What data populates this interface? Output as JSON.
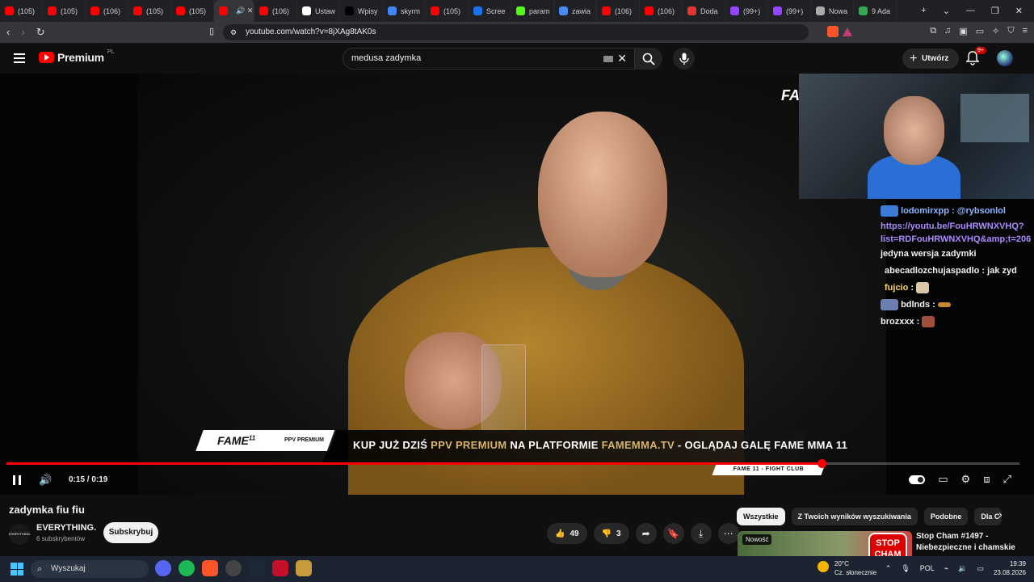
{
  "browser": {
    "tabs": [
      {
        "label": "(105)",
        "icon": "youtube-icon",
        "color": "#ff0000"
      },
      {
        "label": "(105)",
        "icon": "youtube-icon",
        "color": "#ff0000"
      },
      {
        "label": "(106)",
        "icon": "youtube-icon",
        "color": "#ff0000"
      },
      {
        "label": "(105)",
        "icon": "youtube-icon",
        "color": "#ff0000"
      },
      {
        "label": "(105)",
        "icon": "youtube-icon",
        "color": "#ff0000"
      },
      {
        "label": "",
        "icon": "youtube-icon",
        "color": "#ff0000",
        "active": true
      },
      {
        "label": "(106)",
        "icon": "youtube-icon",
        "color": "#ff0000"
      },
      {
        "label": "Ustaw",
        "icon": "page-icon",
        "color": "#ffffff"
      },
      {
        "label": "Wpisy",
        "icon": "x-icon",
        "color": "#000000"
      },
      {
        "label": "skyrm",
        "icon": "google-icon",
        "color": "#4285f4"
      },
      {
        "label": "(105)",
        "icon": "youtube-icon",
        "color": "#ff0000"
      },
      {
        "label": "Scree",
        "icon": "screen-icon",
        "color": "#1a73e8"
      },
      {
        "label": "param",
        "icon": "k-icon",
        "color": "#53fc18"
      },
      {
        "label": "zawia",
        "icon": "doc-icon",
        "color": "#4a8af4"
      },
      {
        "label": "(106)",
        "icon": "youtube-icon",
        "color": "#ff0000"
      },
      {
        "label": "(106)",
        "icon": "youtube-icon",
        "color": "#ff0000"
      },
      {
        "label": "Doda",
        "icon": "dodaj-icon",
        "color": "#e3342f"
      },
      {
        "label": "(99+)",
        "icon": "twitch-icon",
        "color": "#9146ff"
      },
      {
        "label": "(99+)",
        "icon": "twitch-icon",
        "color": "#9146ff"
      },
      {
        "label": "Nowa",
        "icon": "shield-icon",
        "color": "#aaaaaa"
      },
      {
        "label": "9 Ada",
        "icon": "maps-icon",
        "color": "#34a853"
      }
    ],
    "url": "youtube.com/watch?v=8jXAg8tAK0s"
  },
  "youtube": {
    "logo_text": "Premium",
    "region": "PL",
    "search_query": "medusa zadymka",
    "create_label": "Utwórz",
    "notif_badge": "9+"
  },
  "video": {
    "corner_brand": "FA",
    "banner_brand": "FAME",
    "banner_brand_num": "11",
    "banner_ppv": "PPV PREMIUM",
    "banner_msg_1": "KUP JUŻ DZIŚ ",
    "banner_msg_gold_1": "PPV PREMIUM",
    "banner_msg_2": " NA PLATFORMIE ",
    "banner_msg_gold_2": "FAMEMMA.TV",
    "banner_msg_3": " - OGLĄDAJ  GALĘ FAME MMA 11",
    "tag": "FAME 11 - FIGHT CLUB",
    "time": "0:15 / 0:19",
    "progress": 0.805
  },
  "chat": {
    "m1_user": "lodomirxpp",
    "m1_text": " : @rybsonlol",
    "m1_link": "https://youtu.be/FouHRWNXVHQ?list=RDFouHRWNXVHQ&amp;t=206",
    "m2_text": "jedyna wersja zadymki",
    "m3_user": "abecadlozchujaspadlo",
    "m3_text": " : jak zyd",
    "m4_user": "fujcio",
    "m4_text": " :",
    "m5_user": "bdlnds",
    "m5_text": " :",
    "m6_user": "brozxxx",
    "m6_text": " :"
  },
  "below": {
    "title": "zadymka fiu fiu",
    "channel": "EVERYTHING.",
    "channel_avatar_text": "EVERYTHING.",
    "subs": "6 subskrybentów",
    "subscribe": "Subskrybuj",
    "likes": "49",
    "dislikes": "3"
  },
  "chips": [
    "Wszystkie",
    "Z Twoich wyników wyszukiwania",
    "Podobne",
    "Dla C"
  ],
  "recommended": {
    "badge": "Nowość",
    "thumb_text": "STOP CHAM",
    "title": "Stop Cham #1497 - Niebezpieczne i chamskie"
  },
  "taskbar": {
    "search": "Wyszukaj",
    "weather_temp": "20°C",
    "weather_desc": "Cz. słonecznie",
    "lang": "POL",
    "time": "19:39",
    "date": "23.08.2026"
  }
}
